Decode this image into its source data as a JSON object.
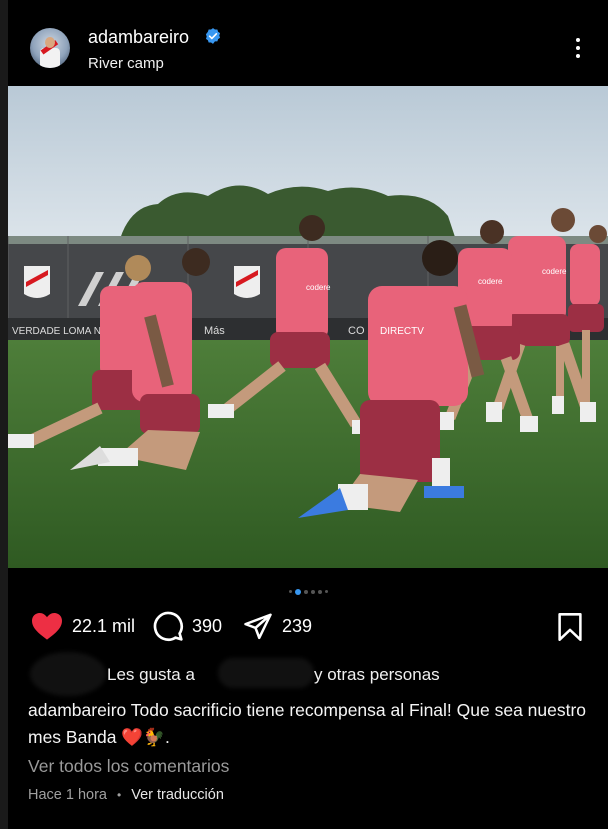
{
  "post": {
    "username": "adambareiro",
    "location": "River camp",
    "likes_count": "22.1 mil",
    "comments_count": "390",
    "shares_count": "239",
    "liked_by_prefix": "Les gusta a",
    "liked_by_suffix": "y otras personas",
    "caption_user": "adambareiro",
    "caption_text": "Todo sacrificio tiene recompensa al Final! Que sea nuestro mes Banda",
    "caption_emojis": "❤️🐓.",
    "view_comments": "Ver todos los comentarios",
    "time_ago": "Hace 1 hora",
    "separator": "•",
    "translate": "Ver traducción",
    "carousel": {
      "count": 6,
      "active": 2
    }
  },
  "photo": {
    "banner_texts": [
      "codere",
      "codere",
      "DIRECTV",
      "codere",
      "codere",
      "Más",
      "VERDADE LOMA NEGRA",
      "CO"
    ]
  },
  "colors": {
    "background": "#000000",
    "like_red": "#ed2f44",
    "carousel_active": "#3897f0",
    "verified_blue": "#3897f0",
    "jersey_pink": "#e8637a",
    "pitch_green": "#3f6f2e"
  }
}
